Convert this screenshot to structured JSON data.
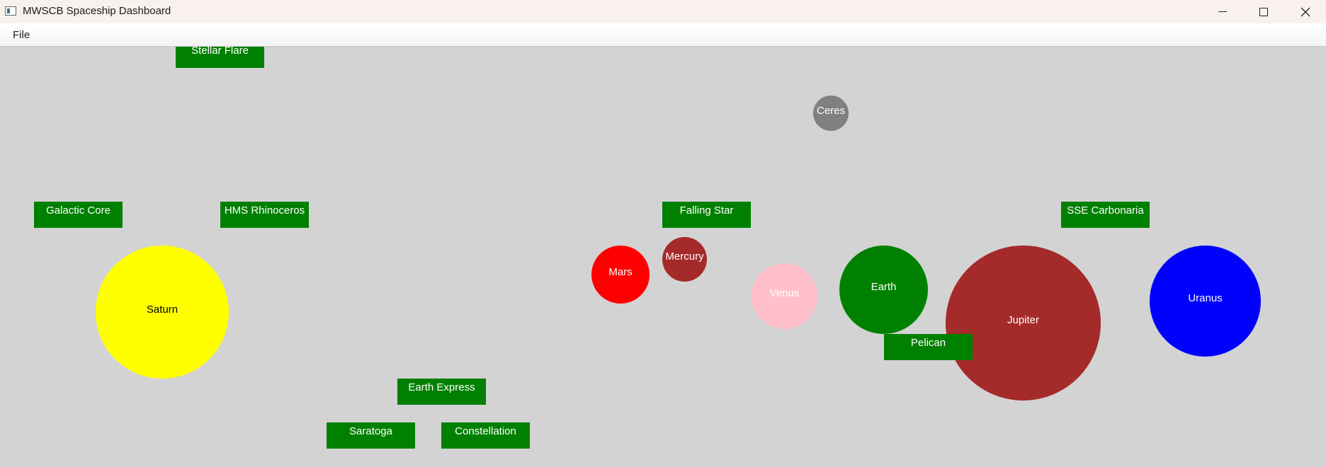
{
  "window": {
    "title": "MWSCB Spaceship Dashboard"
  },
  "menu": {
    "file_label": "File"
  },
  "ships": [
    {
      "name": "Stellar Flare"
    },
    {
      "name": "Galactic Core"
    },
    {
      "name": "HMS Rhinoceros"
    },
    {
      "name": "Falling Star"
    },
    {
      "name": "SSE Carbonaria"
    },
    {
      "name": "Pelican"
    },
    {
      "name": "Earth Express"
    },
    {
      "name": "Saratoga"
    },
    {
      "name": "Constellation"
    }
  ],
  "planets": [
    {
      "name": "Ceres",
      "color": "#808080"
    },
    {
      "name": "Saturn",
      "color": "#ffff00"
    },
    {
      "name": "Mars",
      "color": "#ff0000"
    },
    {
      "name": "Mercury",
      "color": "#a52a2a"
    },
    {
      "name": "Venus",
      "color": "#ffc0cb"
    },
    {
      "name": "Earth",
      "color": "#008000"
    },
    {
      "name": "Jupiter",
      "color": "#a52a2a"
    },
    {
      "name": "Uranus",
      "color": "#0000ff"
    }
  ],
  "colors": {
    "ship": "#008000",
    "canvas_background": "#d3d3d3"
  }
}
